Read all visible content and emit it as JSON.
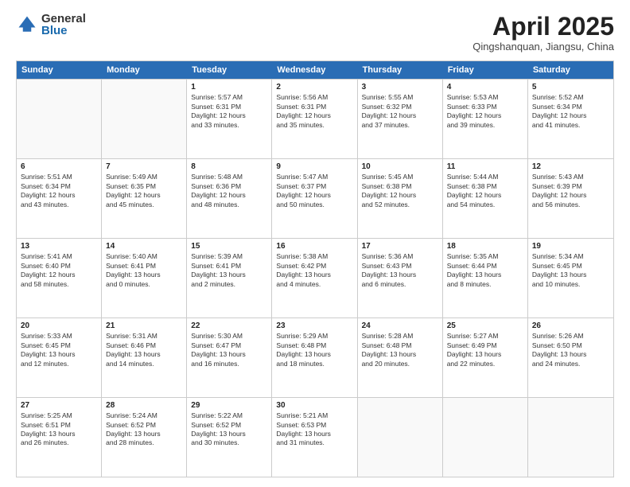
{
  "logo": {
    "general": "General",
    "blue": "Blue"
  },
  "header": {
    "month": "April 2025",
    "location": "Qingshanquan, Jiangsu, China"
  },
  "weekdays": [
    "Sunday",
    "Monday",
    "Tuesday",
    "Wednesday",
    "Thursday",
    "Friday",
    "Saturday"
  ],
  "rows": [
    [
      {
        "day": "",
        "empty": true
      },
      {
        "day": "",
        "empty": true
      },
      {
        "day": "1",
        "line1": "Sunrise: 5:57 AM",
        "line2": "Sunset: 6:31 PM",
        "line3": "Daylight: 12 hours",
        "line4": "and 33 minutes."
      },
      {
        "day": "2",
        "line1": "Sunrise: 5:56 AM",
        "line2": "Sunset: 6:31 PM",
        "line3": "Daylight: 12 hours",
        "line4": "and 35 minutes."
      },
      {
        "day": "3",
        "line1": "Sunrise: 5:55 AM",
        "line2": "Sunset: 6:32 PM",
        "line3": "Daylight: 12 hours",
        "line4": "and 37 minutes."
      },
      {
        "day": "4",
        "line1": "Sunrise: 5:53 AM",
        "line2": "Sunset: 6:33 PM",
        "line3": "Daylight: 12 hours",
        "line4": "and 39 minutes."
      },
      {
        "day": "5",
        "line1": "Sunrise: 5:52 AM",
        "line2": "Sunset: 6:34 PM",
        "line3": "Daylight: 12 hours",
        "line4": "and 41 minutes."
      }
    ],
    [
      {
        "day": "6",
        "line1": "Sunrise: 5:51 AM",
        "line2": "Sunset: 6:34 PM",
        "line3": "Daylight: 12 hours",
        "line4": "and 43 minutes."
      },
      {
        "day": "7",
        "line1": "Sunrise: 5:49 AM",
        "line2": "Sunset: 6:35 PM",
        "line3": "Daylight: 12 hours",
        "line4": "and 45 minutes."
      },
      {
        "day": "8",
        "line1": "Sunrise: 5:48 AM",
        "line2": "Sunset: 6:36 PM",
        "line3": "Daylight: 12 hours",
        "line4": "and 48 minutes."
      },
      {
        "day": "9",
        "line1": "Sunrise: 5:47 AM",
        "line2": "Sunset: 6:37 PM",
        "line3": "Daylight: 12 hours",
        "line4": "and 50 minutes."
      },
      {
        "day": "10",
        "line1": "Sunrise: 5:45 AM",
        "line2": "Sunset: 6:38 PM",
        "line3": "Daylight: 12 hours",
        "line4": "and 52 minutes."
      },
      {
        "day": "11",
        "line1": "Sunrise: 5:44 AM",
        "line2": "Sunset: 6:38 PM",
        "line3": "Daylight: 12 hours",
        "line4": "and 54 minutes."
      },
      {
        "day": "12",
        "line1": "Sunrise: 5:43 AM",
        "line2": "Sunset: 6:39 PM",
        "line3": "Daylight: 12 hours",
        "line4": "and 56 minutes."
      }
    ],
    [
      {
        "day": "13",
        "line1": "Sunrise: 5:41 AM",
        "line2": "Sunset: 6:40 PM",
        "line3": "Daylight: 12 hours",
        "line4": "and 58 minutes."
      },
      {
        "day": "14",
        "line1": "Sunrise: 5:40 AM",
        "line2": "Sunset: 6:41 PM",
        "line3": "Daylight: 13 hours",
        "line4": "and 0 minutes."
      },
      {
        "day": "15",
        "line1": "Sunrise: 5:39 AM",
        "line2": "Sunset: 6:41 PM",
        "line3": "Daylight: 13 hours",
        "line4": "and 2 minutes."
      },
      {
        "day": "16",
        "line1": "Sunrise: 5:38 AM",
        "line2": "Sunset: 6:42 PM",
        "line3": "Daylight: 13 hours",
        "line4": "and 4 minutes."
      },
      {
        "day": "17",
        "line1": "Sunrise: 5:36 AM",
        "line2": "Sunset: 6:43 PM",
        "line3": "Daylight: 13 hours",
        "line4": "and 6 minutes."
      },
      {
        "day": "18",
        "line1": "Sunrise: 5:35 AM",
        "line2": "Sunset: 6:44 PM",
        "line3": "Daylight: 13 hours",
        "line4": "and 8 minutes."
      },
      {
        "day": "19",
        "line1": "Sunrise: 5:34 AM",
        "line2": "Sunset: 6:45 PM",
        "line3": "Daylight: 13 hours",
        "line4": "and 10 minutes."
      }
    ],
    [
      {
        "day": "20",
        "line1": "Sunrise: 5:33 AM",
        "line2": "Sunset: 6:45 PM",
        "line3": "Daylight: 13 hours",
        "line4": "and 12 minutes."
      },
      {
        "day": "21",
        "line1": "Sunrise: 5:31 AM",
        "line2": "Sunset: 6:46 PM",
        "line3": "Daylight: 13 hours",
        "line4": "and 14 minutes."
      },
      {
        "day": "22",
        "line1": "Sunrise: 5:30 AM",
        "line2": "Sunset: 6:47 PM",
        "line3": "Daylight: 13 hours",
        "line4": "and 16 minutes."
      },
      {
        "day": "23",
        "line1": "Sunrise: 5:29 AM",
        "line2": "Sunset: 6:48 PM",
        "line3": "Daylight: 13 hours",
        "line4": "and 18 minutes."
      },
      {
        "day": "24",
        "line1": "Sunrise: 5:28 AM",
        "line2": "Sunset: 6:48 PM",
        "line3": "Daylight: 13 hours",
        "line4": "and 20 minutes."
      },
      {
        "day": "25",
        "line1": "Sunrise: 5:27 AM",
        "line2": "Sunset: 6:49 PM",
        "line3": "Daylight: 13 hours",
        "line4": "and 22 minutes."
      },
      {
        "day": "26",
        "line1": "Sunrise: 5:26 AM",
        "line2": "Sunset: 6:50 PM",
        "line3": "Daylight: 13 hours",
        "line4": "and 24 minutes."
      }
    ],
    [
      {
        "day": "27",
        "line1": "Sunrise: 5:25 AM",
        "line2": "Sunset: 6:51 PM",
        "line3": "Daylight: 13 hours",
        "line4": "and 26 minutes."
      },
      {
        "day": "28",
        "line1": "Sunrise: 5:24 AM",
        "line2": "Sunset: 6:52 PM",
        "line3": "Daylight: 13 hours",
        "line4": "and 28 minutes."
      },
      {
        "day": "29",
        "line1": "Sunrise: 5:22 AM",
        "line2": "Sunset: 6:52 PM",
        "line3": "Daylight: 13 hours",
        "line4": "and 30 minutes."
      },
      {
        "day": "30",
        "line1": "Sunrise: 5:21 AM",
        "line2": "Sunset: 6:53 PM",
        "line3": "Daylight: 13 hours",
        "line4": "and 31 minutes."
      },
      {
        "day": "",
        "empty": true
      },
      {
        "day": "",
        "empty": true
      },
      {
        "day": "",
        "empty": true
      }
    ]
  ]
}
